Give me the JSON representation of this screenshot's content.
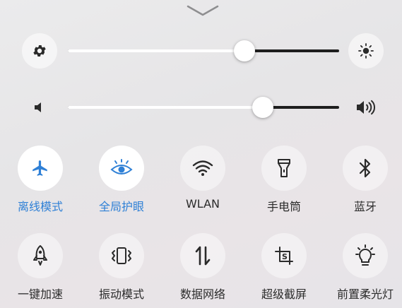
{
  "panel": {
    "collapse_handle": "chevron-down-icon"
  },
  "brightness": {
    "level": 0.65,
    "min_icon": "gear-icon",
    "max_icon": "brightness-sun-icon"
  },
  "volume": {
    "level": 0.72,
    "min_icon": "volume-mute-icon",
    "max_icon": "volume-high-icon"
  },
  "colors": {
    "accent": "#2f80d6",
    "track_dark": "#1e1e1e",
    "track_light": "#ffffff"
  },
  "toggles": [
    {
      "label": "离线模式",
      "icon": "airplane-icon",
      "active": true
    },
    {
      "label": "全局护眼",
      "icon": "eye-icon",
      "active": true
    },
    {
      "label": "WLAN",
      "icon": "wifi-icon",
      "active": false
    },
    {
      "label": "手电筒",
      "icon": "flashlight-icon",
      "active": false
    },
    {
      "label": "蓝牙",
      "icon": "bluetooth-icon",
      "active": false
    },
    {
      "label": "一键加速",
      "icon": "rocket-icon",
      "active": false
    },
    {
      "label": "振动模式",
      "icon": "vibrate-icon",
      "active": false
    },
    {
      "label": "数据网络",
      "icon": "mobile-data-icon",
      "active": false
    },
    {
      "label": "超级截屏",
      "icon": "super-screenshot-icon",
      "active": false
    },
    {
      "label": "前置柔光灯",
      "icon": "front-light-bulb-icon",
      "active": false
    }
  ]
}
